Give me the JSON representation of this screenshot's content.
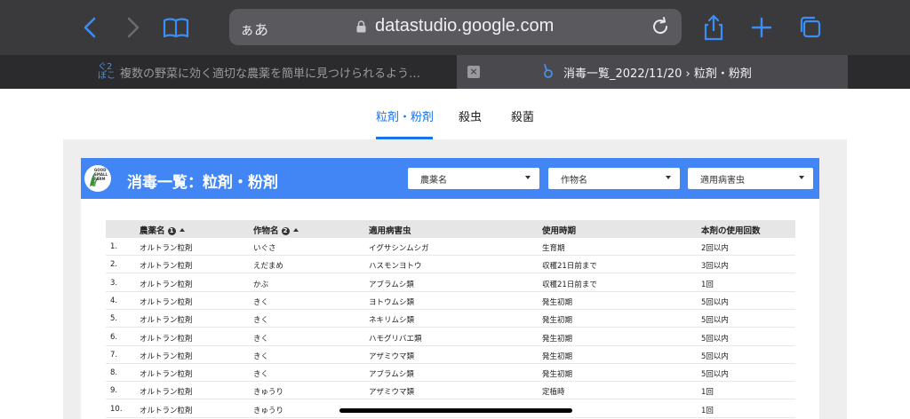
{
  "browser": {
    "address_prefix": "ぁあ",
    "url": "datastudio.google.com",
    "tabs": [
      {
        "title": "複数の野菜に効く適切な農薬を簡単に見つけられるよう…",
        "icon": "ぐ2ぽこ"
      },
      {
        "title": "消毒一覧_2022/11/20 › 粒剤・粉剤"
      }
    ]
  },
  "page_tabs": [
    "粒剤・粉剤",
    "殺虫",
    "殺菌"
  ],
  "report": {
    "logo_text": "GOOD SMALL FARM",
    "title": "消毒一覧：粒剤・粉剤",
    "filters": [
      "農薬名",
      "作物名",
      "適用病害虫"
    ]
  },
  "table": {
    "headers": [
      "農薬名",
      "作物名",
      "適用病害虫",
      "使用時期",
      "本剤の使用回数"
    ],
    "sort_numbers": [
      "1",
      "2"
    ],
    "rows": [
      {
        "n": "1.",
        "pesticide": "オルトラン粒剤",
        "crop": "いぐさ",
        "pest": "イグサシンムシガ",
        "timing": "生育期",
        "count": "2回以内"
      },
      {
        "n": "2.",
        "pesticide": "オルトラン粒剤",
        "crop": "えだまめ",
        "pest": "ハスモンヨトウ",
        "timing": "収穫21日前まで",
        "count": "3回以内"
      },
      {
        "n": "3.",
        "pesticide": "オルトラン粒剤",
        "crop": "かぶ",
        "pest": "アブラムシ類",
        "timing": "収穫21日前まで",
        "count": "1回"
      },
      {
        "n": "4.",
        "pesticide": "オルトラン粒剤",
        "crop": "きく",
        "pest": "ヨトウムシ類",
        "timing": "発生初期",
        "count": "5回以内"
      },
      {
        "n": "5.",
        "pesticide": "オルトラン粒剤",
        "crop": "きく",
        "pest": "ネキリムシ類",
        "timing": "発生初期",
        "count": "5回以内"
      },
      {
        "n": "6.",
        "pesticide": "オルトラン粒剤",
        "crop": "きく",
        "pest": "ハモグリバエ類",
        "timing": "発生初期",
        "count": "5回以内"
      },
      {
        "n": "7.",
        "pesticide": "オルトラン粒剤",
        "crop": "きく",
        "pest": "アザミウマ類",
        "timing": "発生初期",
        "count": "5回以内"
      },
      {
        "n": "8.",
        "pesticide": "オルトラン粒剤",
        "crop": "きく",
        "pest": "アブラムシ類",
        "timing": "発生初期",
        "count": "5回以内"
      },
      {
        "n": "9.",
        "pesticide": "オルトラン粒剤",
        "crop": "きゅうり",
        "pest": "アザミウマ類",
        "timing": "定植時",
        "count": "1回"
      },
      {
        "n": "10.",
        "pesticide": "オルトラン粒剤",
        "crop": "きゅうり",
        "pest": "",
        "timing": "",
        "count": "1回"
      }
    ]
  },
  "colors": {
    "accent": "#4285f4",
    "tab_active": "#1a73e8",
    "ios_blue": "#3c8ef7"
  },
  "icons": [
    "back-icon",
    "forward-icon",
    "bookmarks-icon",
    "lock-icon",
    "reload-icon",
    "share-icon",
    "new-tab-icon",
    "tabs-icon",
    "close-tab-icon",
    "app-icon"
  ]
}
